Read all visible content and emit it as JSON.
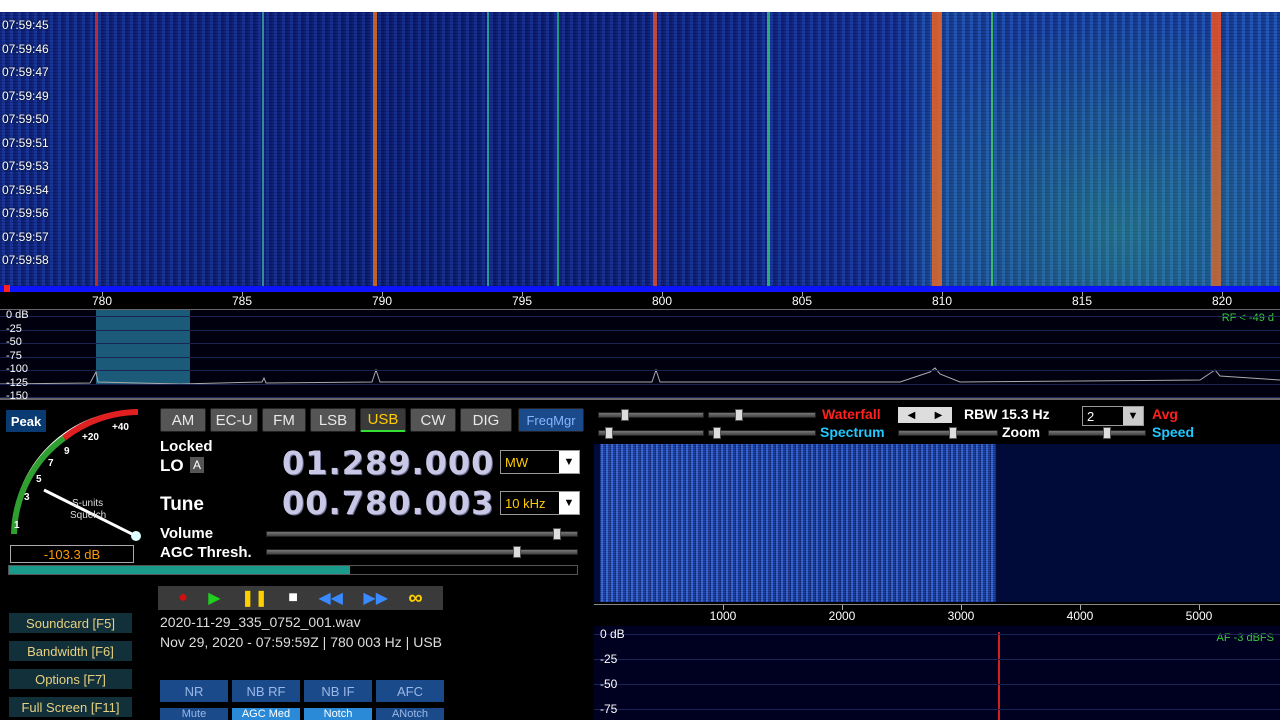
{
  "waterfall": {
    "times": [
      "07:59:45",
      "07:59:46",
      "07:59:47",
      "07:59:49",
      "07:59:50",
      "07:59:51",
      "07:59:53",
      "07:59:54",
      "07:59:56",
      "07:59:57",
      "07:59:58"
    ],
    "freq_labels": [
      "780",
      "785",
      "790",
      "795",
      "800",
      "805",
      "810",
      "815",
      "820"
    ]
  },
  "spectrum": {
    "db_labels": [
      "0 dB",
      "-25",
      "-50",
      "-75",
      "-100",
      "-125",
      "-150"
    ],
    "rf_readout": "RF < -49 d"
  },
  "controls": {
    "peak_label": "Peak",
    "modes": [
      "AM",
      "EC-U",
      "FM",
      "LSB",
      "USB",
      "CW",
      "DIG"
    ],
    "active_mode": "USB",
    "freqmgr_label": "FreqMgr",
    "locked_label": "Locked",
    "lo_label": "LO",
    "lo_badge": "A",
    "lo_freq": "01.289.000",
    "lo_band": "MW",
    "tune_label": "Tune",
    "tune_freq": "00.780.003",
    "tune_step": "10 kHz",
    "volume_label": "Volume",
    "agc_label": "AGC Thresh.",
    "meter": {
      "scale": [
        "1",
        "3",
        "5",
        "7",
        "9",
        "+20",
        "+40"
      ],
      "title1": "S-units",
      "title2": "Squelch",
      "value": "-103.3 dB",
      "level": 0.6
    }
  },
  "file": {
    "name": "2020-11-29_335_0752_001.wav",
    "info": "Nov 29, 2020 - 07:59:59Z | 780 003 Hz | USB"
  },
  "side_buttons": [
    "Soundcard [F5]",
    "Bandwidth [F6]",
    "Options [F7]",
    "Full Screen [F11]"
  ],
  "nr_buttons": [
    "NR",
    "NB RF",
    "NB IF",
    "AFC"
  ],
  "nr_row2": [
    "Mute",
    "AGC Med",
    "Notch",
    "ANotch"
  ],
  "af": {
    "waterfall_label": "Waterfall",
    "spectrum_label": "Spectrum",
    "rbw": "RBW 15.3 Hz",
    "avg_value": "2",
    "avg_label": "Avg",
    "zoom_label": "Zoom",
    "speed_label": "Speed",
    "axis": [
      "1000",
      "2000",
      "3000",
      "4000",
      "5000"
    ],
    "db_labels": [
      "0 dB",
      "-25",
      "-50",
      "-75"
    ],
    "af_readout": "AF  -3 dBFS"
  },
  "colors": {
    "accent": "#ffcc00",
    "waterfall_label": "#ff2020",
    "spectrum_label": "#20c8ff"
  }
}
